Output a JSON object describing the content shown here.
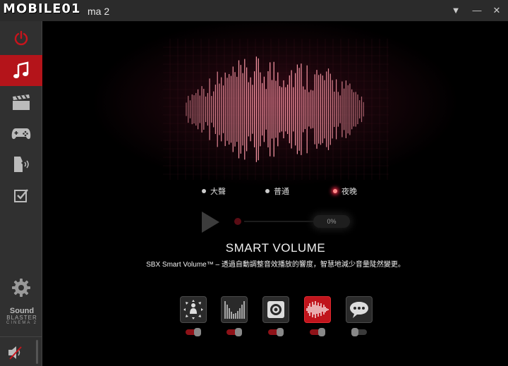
{
  "app": {
    "watermark": "MOBILE01",
    "title": "ma 2"
  },
  "titlebar": {
    "dropdown_glyph": "▼",
    "minimize_glyph": "—",
    "close_glyph": "✕"
  },
  "sidebar": {
    "items": [
      {
        "icon": "power-icon",
        "active": false
      },
      {
        "icon": "music-note-icon",
        "active": true
      },
      {
        "icon": "clapperboard-icon",
        "active": false
      },
      {
        "icon": "gamepad-icon",
        "active": false
      },
      {
        "icon": "voice-icon",
        "active": false
      },
      {
        "icon": "checkbox-icon",
        "active": false
      }
    ],
    "settings_icon": "gear-icon",
    "logo": {
      "line1": "Sound",
      "line2": "BLASTER",
      "line3": "CINEMA 2"
    },
    "volume_icon": "speaker-muted-icon"
  },
  "modes": [
    {
      "label": "大聲",
      "selected": false
    },
    {
      "label": "普通",
      "selected": false
    },
    {
      "label": "夜晚",
      "selected": true
    }
  ],
  "player": {
    "progress_label": "0%",
    "progress": 0
  },
  "feature": {
    "title": "SMART VOLUME",
    "description": "SBX Smart Volume™ – 透過自動調整音效播放的響度，智慧地減少音量陡然變更。"
  },
  "feature_buttons": [
    {
      "icon": "surround-icon",
      "active": false,
      "toggle_on": true
    },
    {
      "icon": "crystalizer-icon",
      "active": false,
      "toggle_on": true
    },
    {
      "icon": "bass-speaker-icon",
      "active": false,
      "toggle_on": true
    },
    {
      "icon": "smart-volume-icon",
      "active": true,
      "toggle_on": true
    },
    {
      "icon": "dialog-plus-icon",
      "active": false,
      "toggle_on": false
    }
  ],
  "colors": {
    "accent": "#b4141a",
    "wave": "#ff9aa8"
  }
}
